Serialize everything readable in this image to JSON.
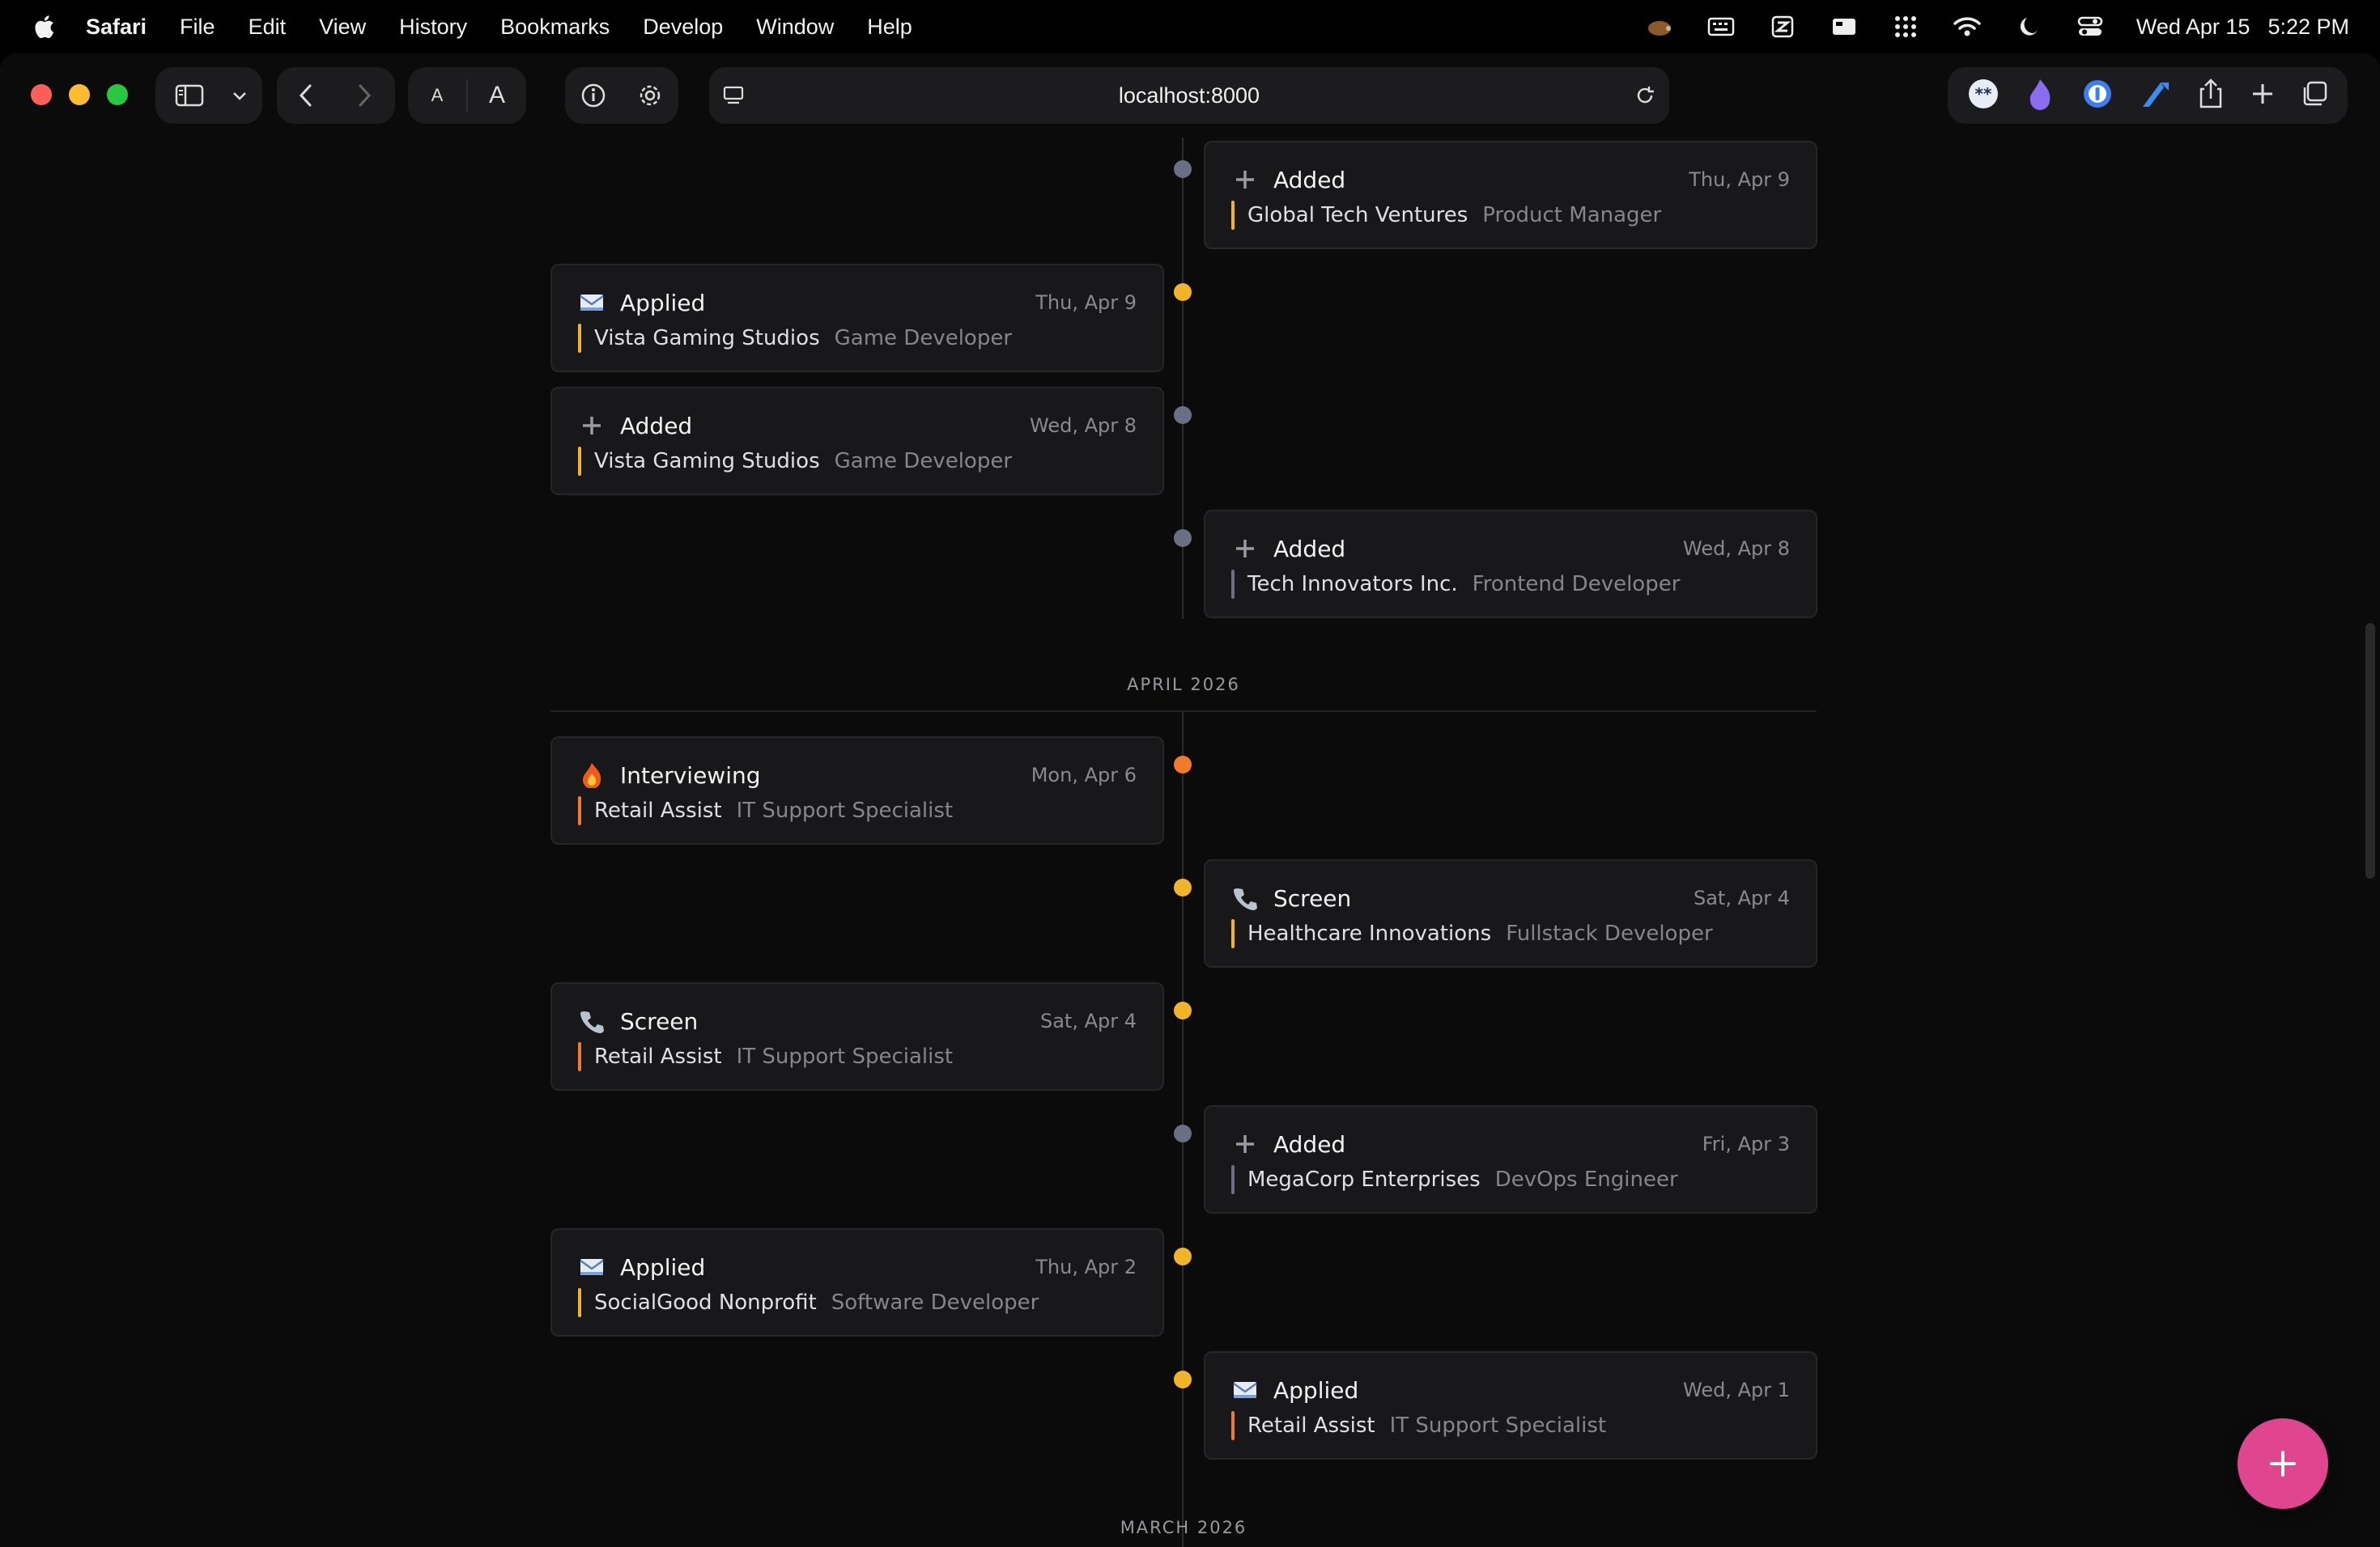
{
  "menubar": {
    "app_name": "Safari",
    "items": [
      "File",
      "Edit",
      "View",
      "History",
      "Bookmarks",
      "Develop",
      "Window",
      "Help"
    ],
    "clock_date": "Wed Apr 15",
    "clock_time": "5:22 PM"
  },
  "browser": {
    "url": "localhost:8000",
    "reader_small": "A",
    "reader_large": "A"
  },
  "timeline": {
    "months": [
      "APRIL 2026",
      "MARCH 2026"
    ],
    "events": [
      {
        "side": "right",
        "label": "Added",
        "date": "Thu, Apr 9",
        "company": "Global Tech Ventures",
        "role": "Product Manager",
        "color": "gray",
        "bar": "yellow",
        "icon": "plus-icon"
      },
      {
        "side": "left",
        "label": "Applied",
        "date": "Thu, Apr 9",
        "company": "Vista Gaming Studios",
        "role": "Game Developer",
        "color": "yellow",
        "bar": "yellow",
        "icon": "envelope-icon"
      },
      {
        "side": "left",
        "label": "Added",
        "date": "Wed, Apr 8",
        "company": "Vista Gaming Studios",
        "role": "Game Developer",
        "color": "gray",
        "bar": "yellow",
        "icon": "plus-icon"
      },
      {
        "side": "right",
        "label": "Added",
        "date": "Wed, Apr 8",
        "company": "Tech Innovators Inc.",
        "role": "Frontend Developer",
        "color": "gray",
        "bar": "gray",
        "icon": "plus-icon"
      },
      {
        "side": "left",
        "label": "Interviewing",
        "date": "Mon, Apr 6",
        "company": "Retail Assist",
        "role": "IT Support Specialist",
        "color": "orange",
        "bar": "orange",
        "icon": "fire-icon"
      },
      {
        "side": "right",
        "label": "Screen",
        "date": "Sat, Apr 4",
        "company": "Healthcare Innovations",
        "role": "Fullstack Developer",
        "color": "yellow",
        "bar": "yellow",
        "icon": "phone-icon"
      },
      {
        "side": "left",
        "label": "Screen",
        "date": "Sat, Apr 4",
        "company": "Retail Assist",
        "role": "IT Support Specialist",
        "color": "yellow",
        "bar": "orange",
        "icon": "phone-icon"
      },
      {
        "side": "right",
        "label": "Added",
        "date": "Fri, Apr 3",
        "company": "MegaCorp Enterprises",
        "role": "DevOps Engineer",
        "color": "gray",
        "bar": "gray",
        "icon": "plus-icon"
      },
      {
        "side": "left",
        "label": "Applied",
        "date": "Thu, Apr 2",
        "company": "SocialGood Nonprofit",
        "role": "Software Developer",
        "color": "yellow",
        "bar": "yellow",
        "icon": "envelope-icon"
      },
      {
        "side": "right",
        "label": "Applied",
        "date": "Wed, Apr 1",
        "company": "Retail Assist",
        "role": "IT Support Specialist",
        "color": "yellow",
        "bar": "orange",
        "icon": "envelope-icon"
      }
    ]
  },
  "fab": {
    "label": "+",
    "color": "#e0468f"
  }
}
